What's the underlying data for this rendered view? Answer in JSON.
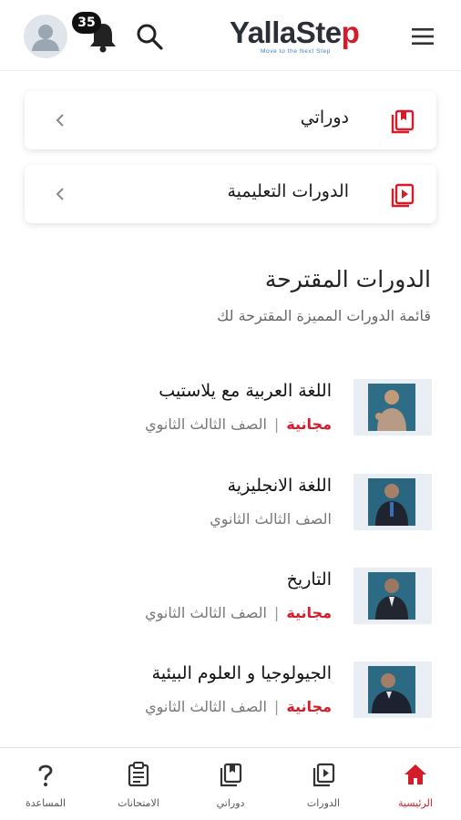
{
  "header": {
    "logo": "YallaStep",
    "logo_tagline": "Move to the Next Step",
    "notification_count": "35",
    "icons": [
      "avatar-icon",
      "bell-icon",
      "search-icon",
      "menu-icon"
    ]
  },
  "cards": [
    {
      "label": "دوراتي",
      "icon": "book-icon"
    },
    {
      "label": "الدورات التعليمية",
      "icon": "play-icon"
    }
  ],
  "section": {
    "title": "الدورات المقترحة",
    "subtitle": "قائمة الدورات المميزة المقترحة لك"
  },
  "courses": [
    {
      "title": "اللغة العربية مع يلاستيب",
      "grade": "الصف الثالث الثانوي",
      "free": "مجانية"
    },
    {
      "title": "اللغة الانجليزية",
      "grade": "الصف الثالث الثانوي",
      "free": ""
    },
    {
      "title": "التاريخ",
      "grade": "الصف الثالث الثانوي",
      "free": "مجانية"
    },
    {
      "title": "الجيولوجيا و العلوم البيئية",
      "grade": "الصف الثالث الثانوي",
      "free": "مجانية"
    }
  ],
  "bottom_nav": [
    {
      "label": "الرئيسية",
      "icon": "home-icon",
      "active": true
    },
    {
      "label": "الدورات",
      "icon": "courses-icon",
      "active": false
    },
    {
      "label": "دوراتي",
      "icon": "my-courses-icon",
      "active": false
    },
    {
      "label": "الامتحانات",
      "icon": "exams-icon",
      "active": false
    },
    {
      "label": "المساعدة",
      "icon": "help-icon",
      "active": false
    }
  ],
  "colors": {
    "accent": "#d41c2a",
    "text": "#222222",
    "muted": "#777777"
  }
}
